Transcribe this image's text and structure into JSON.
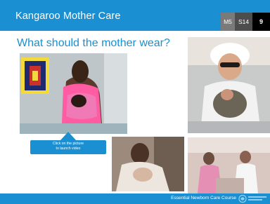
{
  "header": {
    "title": "Kangaroo Mother Care",
    "module": "M5",
    "session": "S14",
    "page": "9"
  },
  "subtitle": "What should the mother wear?",
  "video_button": {
    "line1": "Click on the picture",
    "line2": "to launch video"
  },
  "footer": {
    "course": "Essential Newborn Care Course"
  },
  "photos": [
    {
      "name": "mother-pink-wrap-photo",
      "icon": "photo"
    },
    {
      "name": "mother-white-hat-photo",
      "icon": "photo"
    },
    {
      "name": "mother-in-bed-photo",
      "icon": "photo"
    },
    {
      "name": "nurse-and-mothers-photo",
      "icon": "photo"
    }
  ],
  "colors": {
    "accent": "#1a8fd1",
    "module_tag": "#7a7a7a",
    "session_tag": "#4d4d4d",
    "page_tag": "#000000"
  }
}
